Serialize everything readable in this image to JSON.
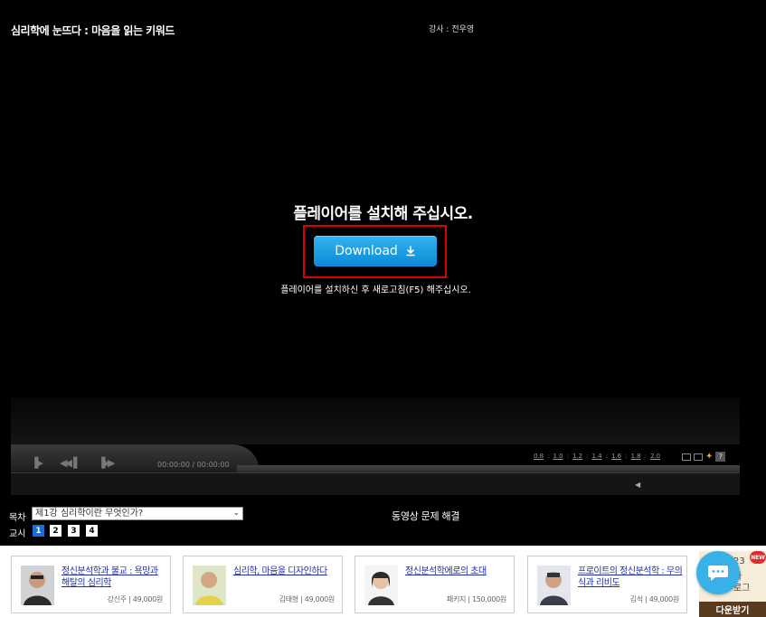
{
  "header": {
    "lecture_title": "심리학에 눈뜨다 : 마음을 읽는 키워드",
    "instructor": "강사 : 전우영"
  },
  "player": {
    "install_message": "플레이어를 설치해 주십시오.",
    "download_label": "Download",
    "refresh_message": "플레이어를 설치하신 후 새로고침(F5) 해주십시오.",
    "time_display": "00:00:00 / 00:00:00",
    "speed_options": [
      "0.8",
      "1.0",
      "1.2",
      "1.4",
      "1.6",
      "1.8",
      "2.0"
    ],
    "help_label": "?"
  },
  "toc": {
    "label": "목차",
    "selected": "제1강 심리학이란 무엇인가?",
    "help_link": "동영상 문제 해결"
  },
  "periods": {
    "label": "교시",
    "items": [
      "1",
      "2",
      "3",
      "4"
    ],
    "active": "1"
  },
  "books": [
    {
      "title": "정신분석학과 불교 : 욕망과 해탈의 심리학",
      "meta": "강신주 | 49,000원"
    },
    {
      "title": "심리학, 마음을 디자인하다",
      "meta": "김태형 | 49,000원"
    },
    {
      "title": "정신분석학에로의 초대",
      "meta": "패키지 | 150,000원"
    },
    {
      "title": "프로이트의 정신분석학 : 무의식과 리비도",
      "meta": "김석 | 49,000원"
    }
  ],
  "banner": {
    "year": "23",
    "text": "카\n로그",
    "new_badge": "NEW",
    "download_label": "다운받기"
  },
  "colors": {
    "download_blue": "#1a9fe3",
    "highlight_red": "#e00000",
    "link_blue": "#1f2ea8",
    "chat_blue": "#38b1e8"
  }
}
